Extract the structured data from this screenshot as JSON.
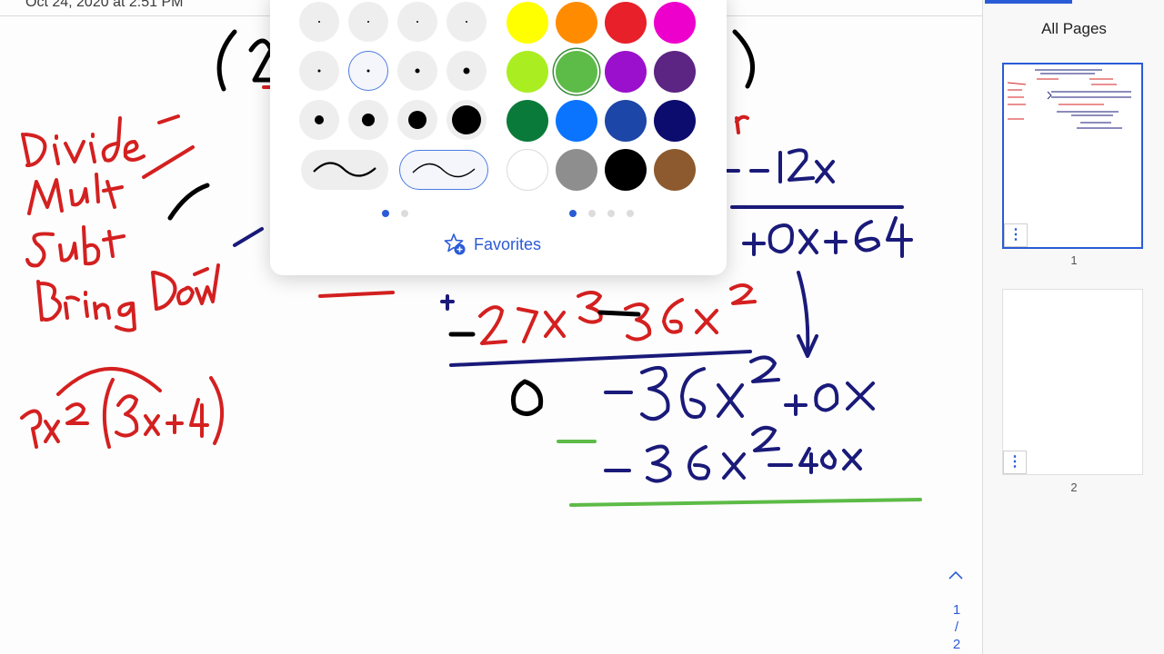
{
  "canvas": {
    "timestamp": "Oct 24, 2020 at 2:51 PM"
  },
  "pages_pane": {
    "title": "All Pages",
    "pages": [
      {
        "number": "1",
        "selected": true
      },
      {
        "number": "2",
        "selected": false
      }
    ],
    "menu_icon": "more-vertical-icon"
  },
  "pen_popover": {
    "favorites_label": "Favorites",
    "favorites_icon": "star-plus-icon",
    "selected_color": "#5dbb47",
    "colors": [
      "#ffff00",
      "#ff8c00",
      "#e8202a",
      "#ee00cc",
      "#aaee22",
      "#5dbb47",
      "#9a10cc",
      "#5c2483",
      "#0a7a3a",
      "#0a74ff",
      "#1c46a8",
      "#0c0c6e",
      "#ffffff",
      "#8e8e8e",
      "#000000",
      "#8c5a2e"
    ]
  },
  "footer": {
    "page_current": "1",
    "page_sep": "/",
    "page_total": "2",
    "up_icon": "chevron-up-icon"
  }
}
